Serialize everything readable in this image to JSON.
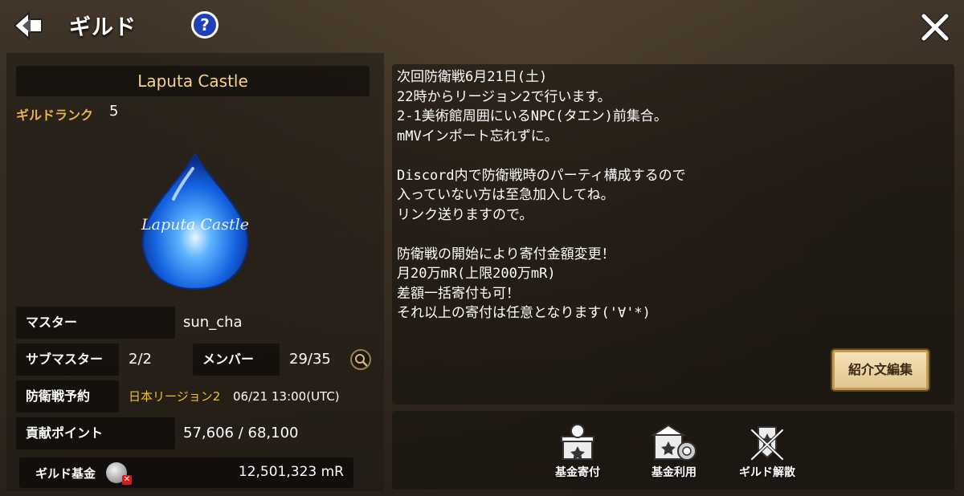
{
  "header": {
    "title": "ギルド",
    "help_label": "?"
  },
  "guild": {
    "name": "Laputa Castle",
    "rank_label": "ギルドランク",
    "rank_value": "5",
    "emblem_text": "Laputa Castle"
  },
  "info": {
    "master_label": "マスター",
    "master_value": "sun_cha",
    "submaster_label": "サブマスター",
    "submaster_value": "2/2",
    "members_label": "メンバー",
    "members_value": "29/35",
    "defense_label": "防衛戦予約",
    "defense_region": "日本リージョン2",
    "defense_time": "06/21 13:00(UTC)",
    "contribution_label": "貢献ポイント",
    "contribution_value": "57,606 / 68,100",
    "fund_label": "ギルド基金",
    "fund_value": "12,501,323 mR"
  },
  "description": {
    "text": "次回防衛戦6月21日(土)\n22時からリージョン2で行います。\n2-1美術館周囲にいるNPC(タエン)前集合。\nmMVインポート忘れずに。\n\nDiscord内で防衛戦時のパーティ構成するので\n入っていない方は至急加入してね。\nリンク送りますので。\n\n防衛戦の開始により寄付金額変更！\n月20万mR(上限200万mR)\n差額一括寄付も可！\nそれ以上の寄付は任意となります('∀'*)",
    "edit_button": "紹介文編集"
  },
  "actions": {
    "donate_label": "基金寄付",
    "use_label": "基金利用",
    "disband_label": "ギルド解散"
  },
  "colors": {
    "gold_text": "#f4d28a",
    "rank_orange": "#e9b24a",
    "region_yellow": "#f2c21c",
    "help_blue": "#1e40b8"
  },
  "icons": [
    "back-arrow-icon",
    "help-icon",
    "close-icon",
    "guild-emblem",
    "magnifier-icon",
    "coin-icon",
    "donate-icon",
    "fund-use-icon",
    "disband-icon"
  ]
}
